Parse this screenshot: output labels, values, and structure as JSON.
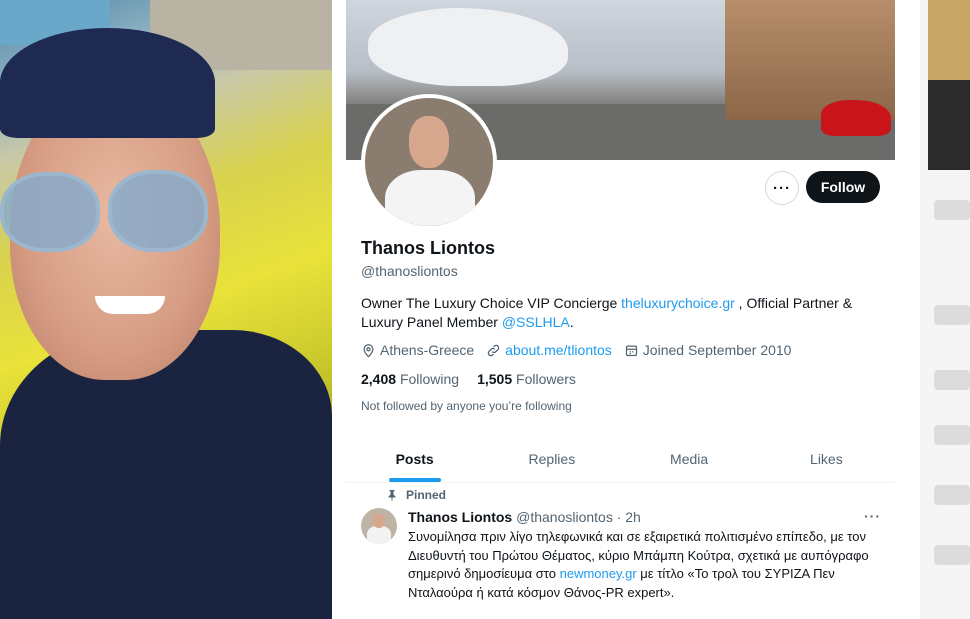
{
  "profile": {
    "name": "Thanos Liontos",
    "handle": "@thanosliontos",
    "bio": {
      "part1": "Owner The Luxury Choice VIP Concierge ",
      "link1": "theluxurychoice.gr",
      "part2": " , Official Partner & Luxury Panel Member ",
      "link2": "@SSLHLA",
      "part3": "."
    },
    "location": "Athens-Greece",
    "website": "about.me/tliontos",
    "joined": "Joined September 2010",
    "following_count": "2,408",
    "following_label": "Following",
    "followers_count": "1,505",
    "followers_label": "Followers",
    "not_followed": "Not followed by anyone you’re following",
    "more_label": "···",
    "follow_label": "Follow"
  },
  "tabs": [
    {
      "label": "Posts",
      "active": true
    },
    {
      "label": "Replies"
    },
    {
      "label": "Media"
    },
    {
      "label": "Likes"
    }
  ],
  "post": {
    "pinned_label": "Pinned",
    "author": "Thanos Liontos",
    "handle_time": "@thanosliontos · 2h",
    "more": "···",
    "text_part1": "Συνομίλησα πριν λίγο τηλεφωνικά και σε εξαιρετικά πολιτισμένο επίπεδο, με τον Διευθυντή του Πρώτου Θέματος, κύριο Μπάμπη Κούτρα, σχετικά με αυπόγραφο σημερινό δημοσίευμα στο ",
    "text_link": "newmoney.gr",
    "text_part2": " με τίτλο «Το τρολ του ΣΥΡΙΖΑ Πεν Νταλαούρα ή κατά κόσμον Θάνος-PR expert»."
  },
  "colors": {
    "accent": "#1d9bf0",
    "text": "#0f1419",
    "muted": "#536471"
  }
}
